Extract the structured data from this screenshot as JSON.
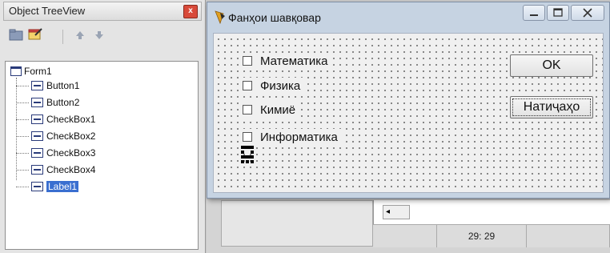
{
  "object_treeview": {
    "title": "Object TreeView",
    "close_glyph": "x",
    "toolbar": {
      "icons": [
        "folder-icon",
        "form-edit-icon",
        "arrow-up-icon",
        "arrow-down-icon"
      ],
      "glyphs": [
        "▣",
        "✉",
        "🡅",
        "🡇"
      ]
    },
    "tree": {
      "root": "Form1",
      "items": [
        {
          "label": "Button1",
          "selected": false
        },
        {
          "label": "Button2",
          "selected": false
        },
        {
          "label": "CheckBox1",
          "selected": false
        },
        {
          "label": "CheckBox2",
          "selected": false
        },
        {
          "label": "CheckBox3",
          "selected": false
        },
        {
          "label": "CheckBox4",
          "selected": false
        },
        {
          "label": "Label1",
          "selected": true
        }
      ]
    }
  },
  "form": {
    "title": "Фанҳои шавқовар",
    "checkboxes": [
      {
        "label": "Математика",
        "checked": false
      },
      {
        "label": "Физика",
        "checked": false
      },
      {
        "label": "Кимиё",
        "checked": false
      },
      {
        "label": "Информатика",
        "checked": false
      }
    ],
    "buttons": {
      "ok": "OK",
      "results": "Натиҷаҳо"
    }
  },
  "status_bar": {
    "cursor_position": "29: 29"
  },
  "colors": {
    "selection": "#3a6fd0",
    "form_frame": "#c6d3e2",
    "close_button": "#d84a3a"
  }
}
